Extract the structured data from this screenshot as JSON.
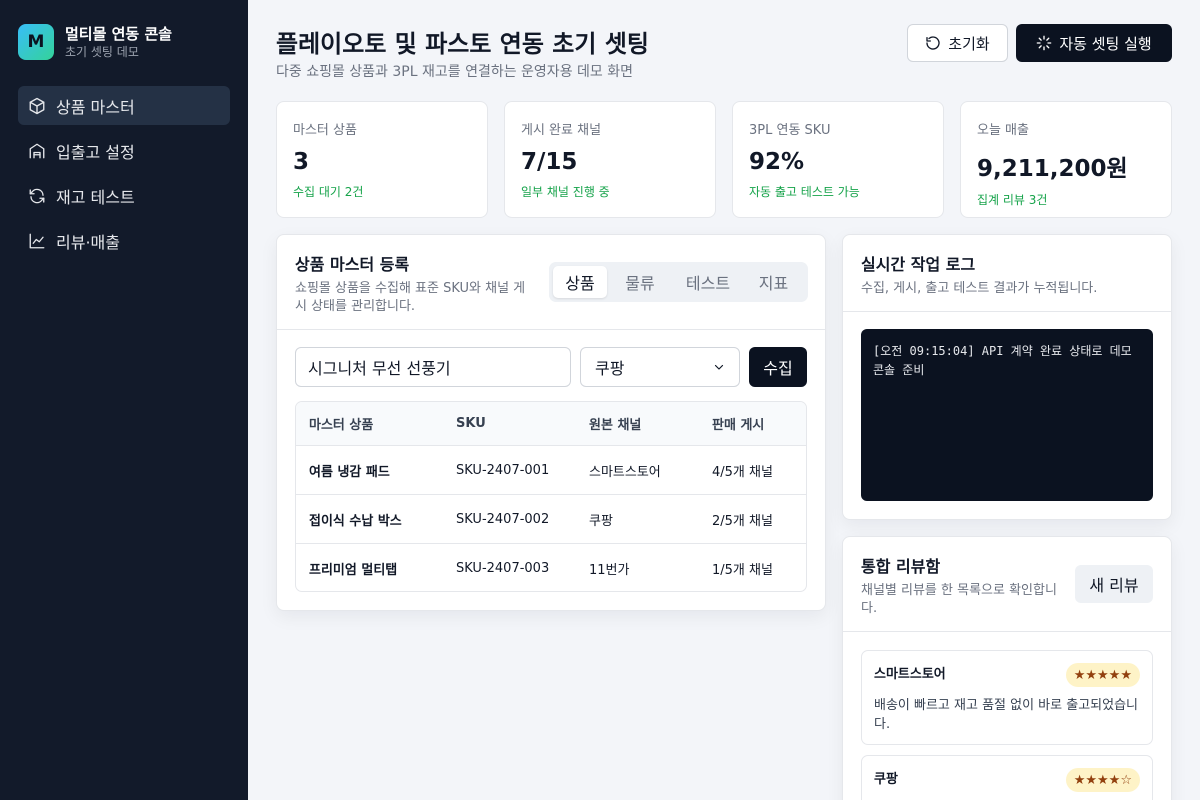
{
  "brand": {
    "logo_letter": "M",
    "title": "멀티몰 연동 콘솔",
    "subtitle": "초기 셋팅 데모",
    "logo_colors": [
      "#38bdf8",
      "#34d399"
    ]
  },
  "sidebar": {
    "items": [
      {
        "label": "상품 마스터",
        "icon": "cube-icon",
        "active": true
      },
      {
        "label": "입출고 설정",
        "icon": "warehouse-icon",
        "active": false
      },
      {
        "label": "재고 테스트",
        "icon": "refresh-icon",
        "active": false
      },
      {
        "label": "리뷰·매출",
        "icon": "chart-icon",
        "active": false
      }
    ]
  },
  "header": {
    "title": "플레이오토 및 파스토 연동 초기 셋팅",
    "subtitle": "다중 쇼핑몰 상품과 3PL 재고를 연결하는 운영자용 데모 화면",
    "reset_label": "초기화",
    "run_label": "자동 셋팅 실행"
  },
  "stats": [
    {
      "label": "마스터 상품",
      "value": "3",
      "note": "수집 대기 2건"
    },
    {
      "label": "게시 완료 채널",
      "value": "7/15",
      "note": "일부 채널 진행 중"
    },
    {
      "label": "3PL 연동 SKU",
      "value": "92%",
      "note": "자동 출고 테스트 가능"
    },
    {
      "label": "오늘 매출",
      "value": "9,211,200원",
      "note": "집계 리뷰 3건"
    }
  ],
  "product_card": {
    "title": "상품 마스터 등록",
    "description": "쇼핑몰 상품을 수집해 표준 SKU와 채널 게시 상태를 관리합니다.",
    "tabs": [
      "상품",
      "물류",
      "테스트",
      "지표"
    ],
    "active_tab": 0,
    "search_value": "시그니처 무선 선풍기",
    "channel_selected": "쿠팡",
    "collect_label": "수집",
    "table": {
      "headers": [
        "마스터 상품",
        "SKU",
        "원본 채널",
        "판매 게시"
      ],
      "rows": [
        [
          "여름 냉감 패드",
          "SKU-2407-001",
          "스마트스토어",
          "4/5개 채널"
        ],
        [
          "접이식 수납 박스",
          "SKU-2407-002",
          "쿠팡",
          "2/5개 채널"
        ],
        [
          "프리미엄 멀티탭",
          "SKU-2407-003",
          "11번가",
          "1/5개 채널"
        ]
      ]
    }
  },
  "log_card": {
    "title": "실시간 작업 로그",
    "description": "수집, 게시, 출고 테스트 결과가 누적됩니다.",
    "log_text": "[오전 09:15:04] API 계약 완료 상태로 데모 콘솔 준비"
  },
  "review_card": {
    "title": "통합 리뷰함",
    "description": "채널별 리뷰를 한 목록으로 확인합니다.",
    "new_review_label": "새 리뷰",
    "reviews": [
      {
        "channel": "스마트스토어",
        "stars": "★★★★★",
        "rating": 5,
        "text": "배송이 빠르고 재고 품절 없이 바로 출고되었습니다."
      },
      {
        "channel": "쿠팡",
        "stars": "★★★★☆",
        "rating": 4,
        "text": ""
      }
    ]
  },
  "colors": {
    "sidebar_bg": "#121a2a",
    "primary_button": "#0b1220",
    "positive_note": "#16a34a",
    "star_badge_bg": "#fef3c7"
  }
}
